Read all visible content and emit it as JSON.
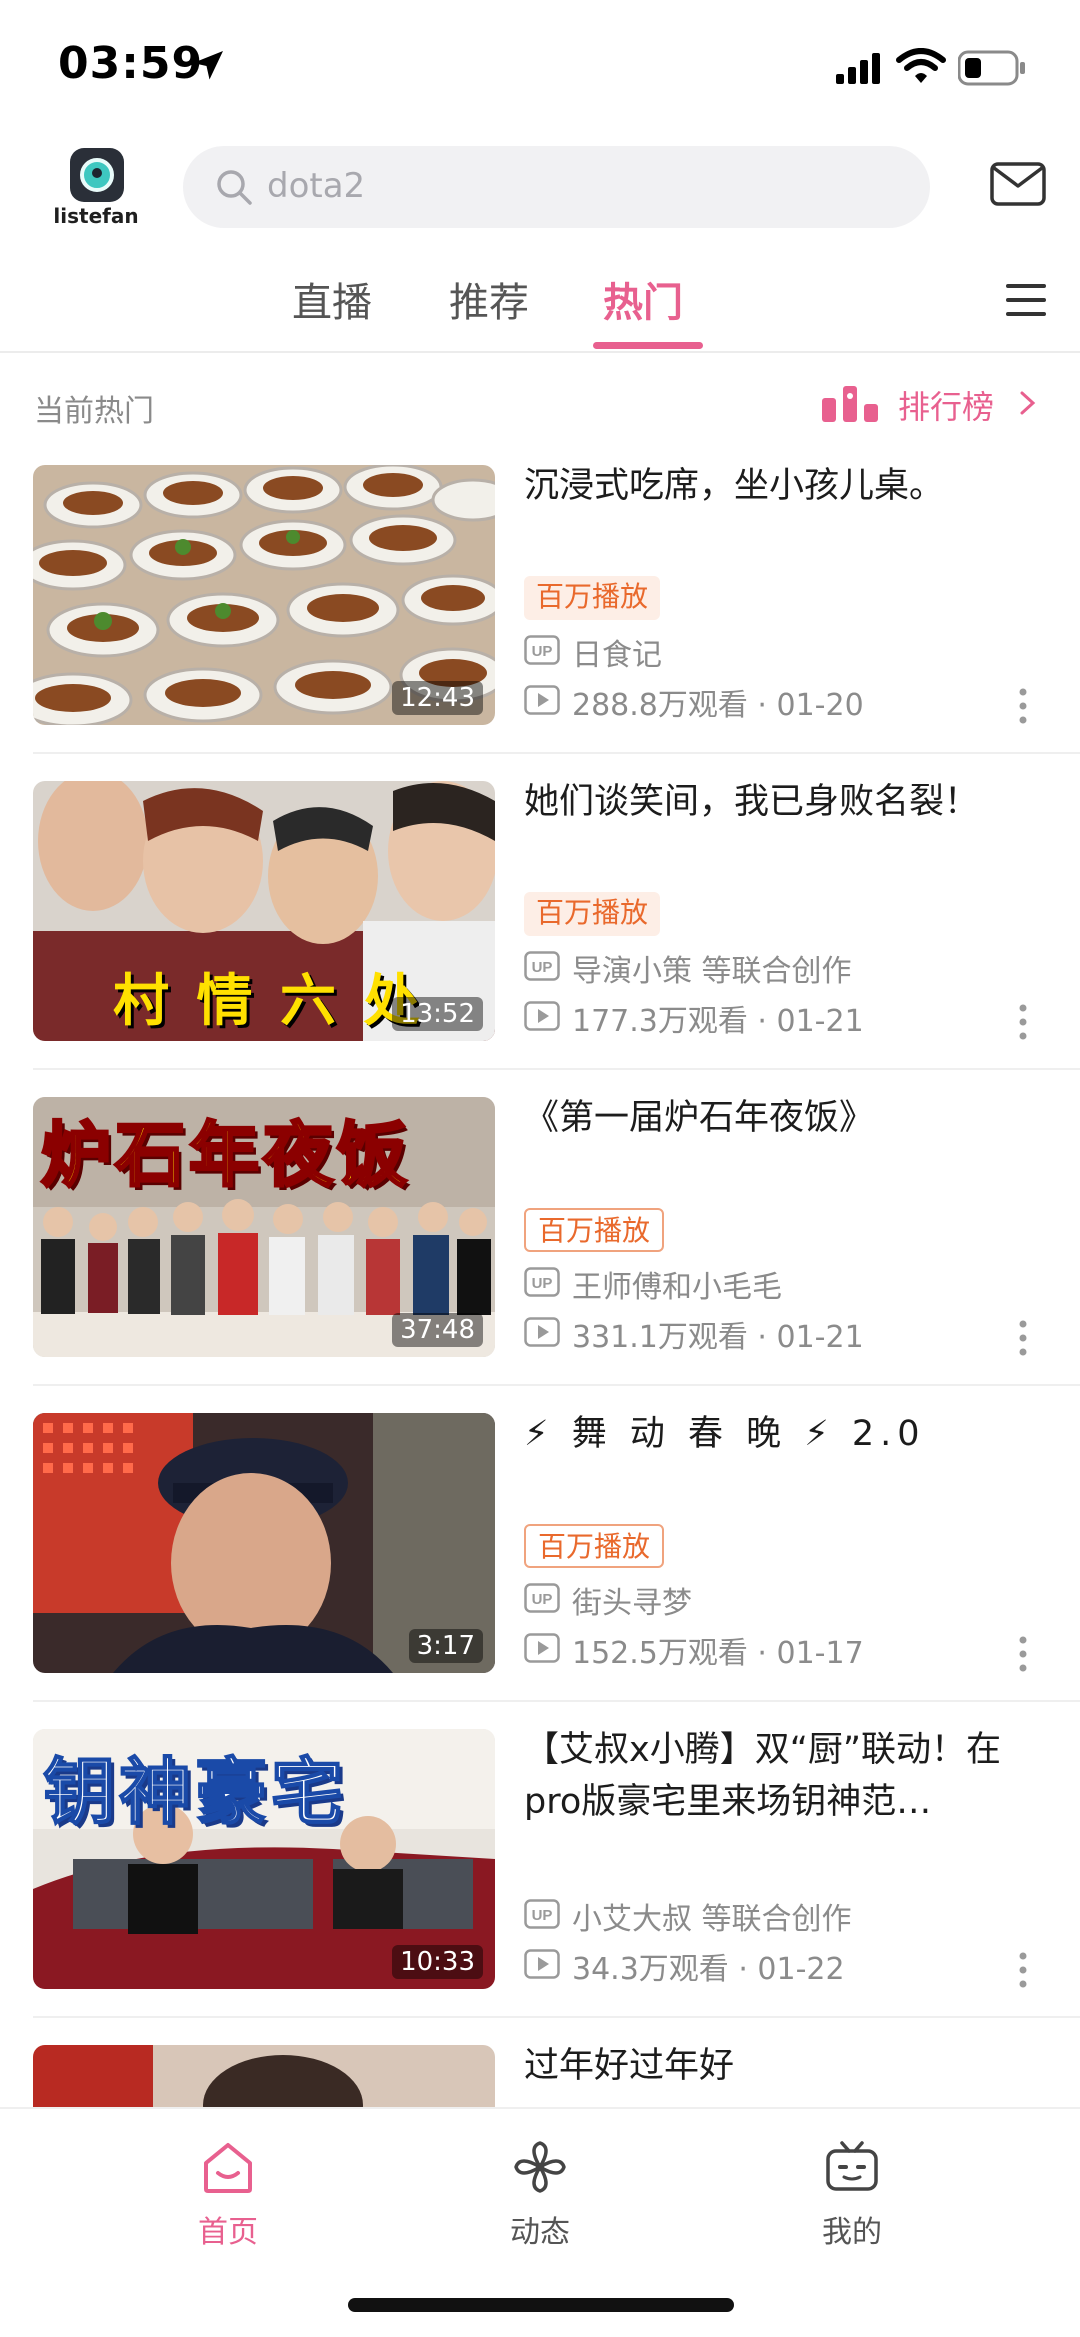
{
  "status_bar": {
    "time": "03:59"
  },
  "header": {
    "logo_text": "listefan",
    "search_placeholder": "dota2"
  },
  "tabs": [
    {
      "label": "直播",
      "active": false
    },
    {
      "label": "推荐",
      "active": false
    },
    {
      "label": "热门",
      "active": true
    }
  ],
  "section": {
    "title": "当前热门",
    "rank_label": "排行榜"
  },
  "videos": [
    {
      "title": "沉浸式吃席，坐小孩儿桌。",
      "badge": "百万播放",
      "uploader": "日食记",
      "views": "288.8万观看",
      "date": "01-20",
      "duration": "12:43"
    },
    {
      "title": "她们谈笑间，我已身败名裂！",
      "badge": "百万播放",
      "uploader": "导演小策 等联合创作",
      "views": "177.3万观看",
      "date": "01-21",
      "duration": "13:52",
      "thumb_caption": "村 情 六 处"
    },
    {
      "title": "《第一届炉石年夜饭》",
      "badge": "百万播放",
      "uploader": "王师傅和小毛毛",
      "views": "331.1万观看",
      "date": "01-21",
      "duration": "37:48",
      "thumb_caption": "炉石年夜饭"
    },
    {
      "title": "⚡ 舞 动 春 晚 ⚡   2.0",
      "badge": "百万播放",
      "uploader": "街头寻梦",
      "views": "152.5万观看",
      "date": "01-17",
      "duration": "3:17"
    },
    {
      "title": "【艾叔x小腾】双“厨”联动！在pro版豪宅里来场钥神范…",
      "badge": "",
      "uploader": "小艾大叔 等联合创作",
      "views": "34.3万观看",
      "date": "01-22",
      "duration": "10:33",
      "thumb_caption": "钥神豪宅"
    },
    {
      "title": "过年好过年好"
    }
  ],
  "bottom_nav": [
    {
      "label": "首页",
      "icon": "home-icon",
      "active": true
    },
    {
      "label": "动态",
      "icon": "pinwheel-icon",
      "active": false
    },
    {
      "label": "我的",
      "icon": "tv-icon",
      "active": false
    }
  ],
  "colors": {
    "accent": "#e8608f",
    "badge": "#e9692c"
  }
}
